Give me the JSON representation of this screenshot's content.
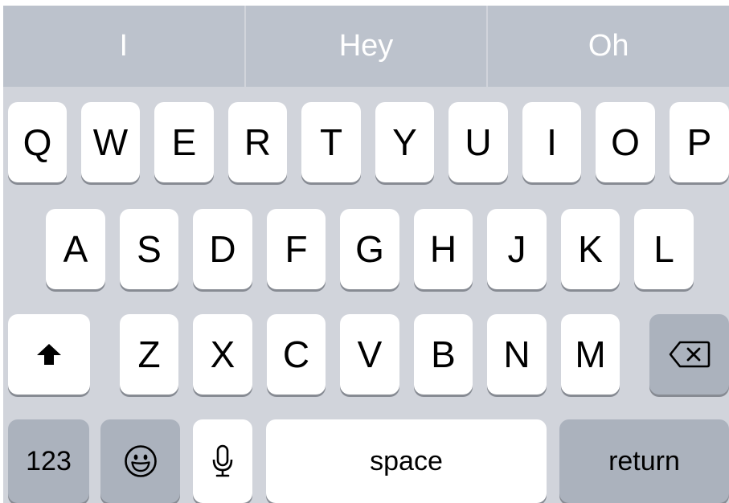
{
  "suggestions": [
    "I",
    "Hey",
    "Oh"
  ],
  "rows": [
    [
      "Q",
      "W",
      "E",
      "R",
      "T",
      "Y",
      "U",
      "I",
      "O",
      "P"
    ],
    [
      "A",
      "S",
      "D",
      "F",
      "G",
      "H",
      "J",
      "K",
      "L"
    ],
    [
      "Z",
      "X",
      "C",
      "V",
      "B",
      "N",
      "M"
    ]
  ],
  "bottom": {
    "numbers_label": "123",
    "space_label": "space",
    "return_label": "return"
  },
  "icons": {
    "shift": "shift-arrow-icon",
    "delete": "backspace-icon",
    "emoji": "smiley-face-icon",
    "dictation": "microphone-icon"
  },
  "colors": {
    "keyboard_background": "#d1d4db",
    "suggestion_bar": "#bcc2cc",
    "letter_key": "#ffffff",
    "function_key": "#abb2bd",
    "key_shadow": "#878b93"
  }
}
